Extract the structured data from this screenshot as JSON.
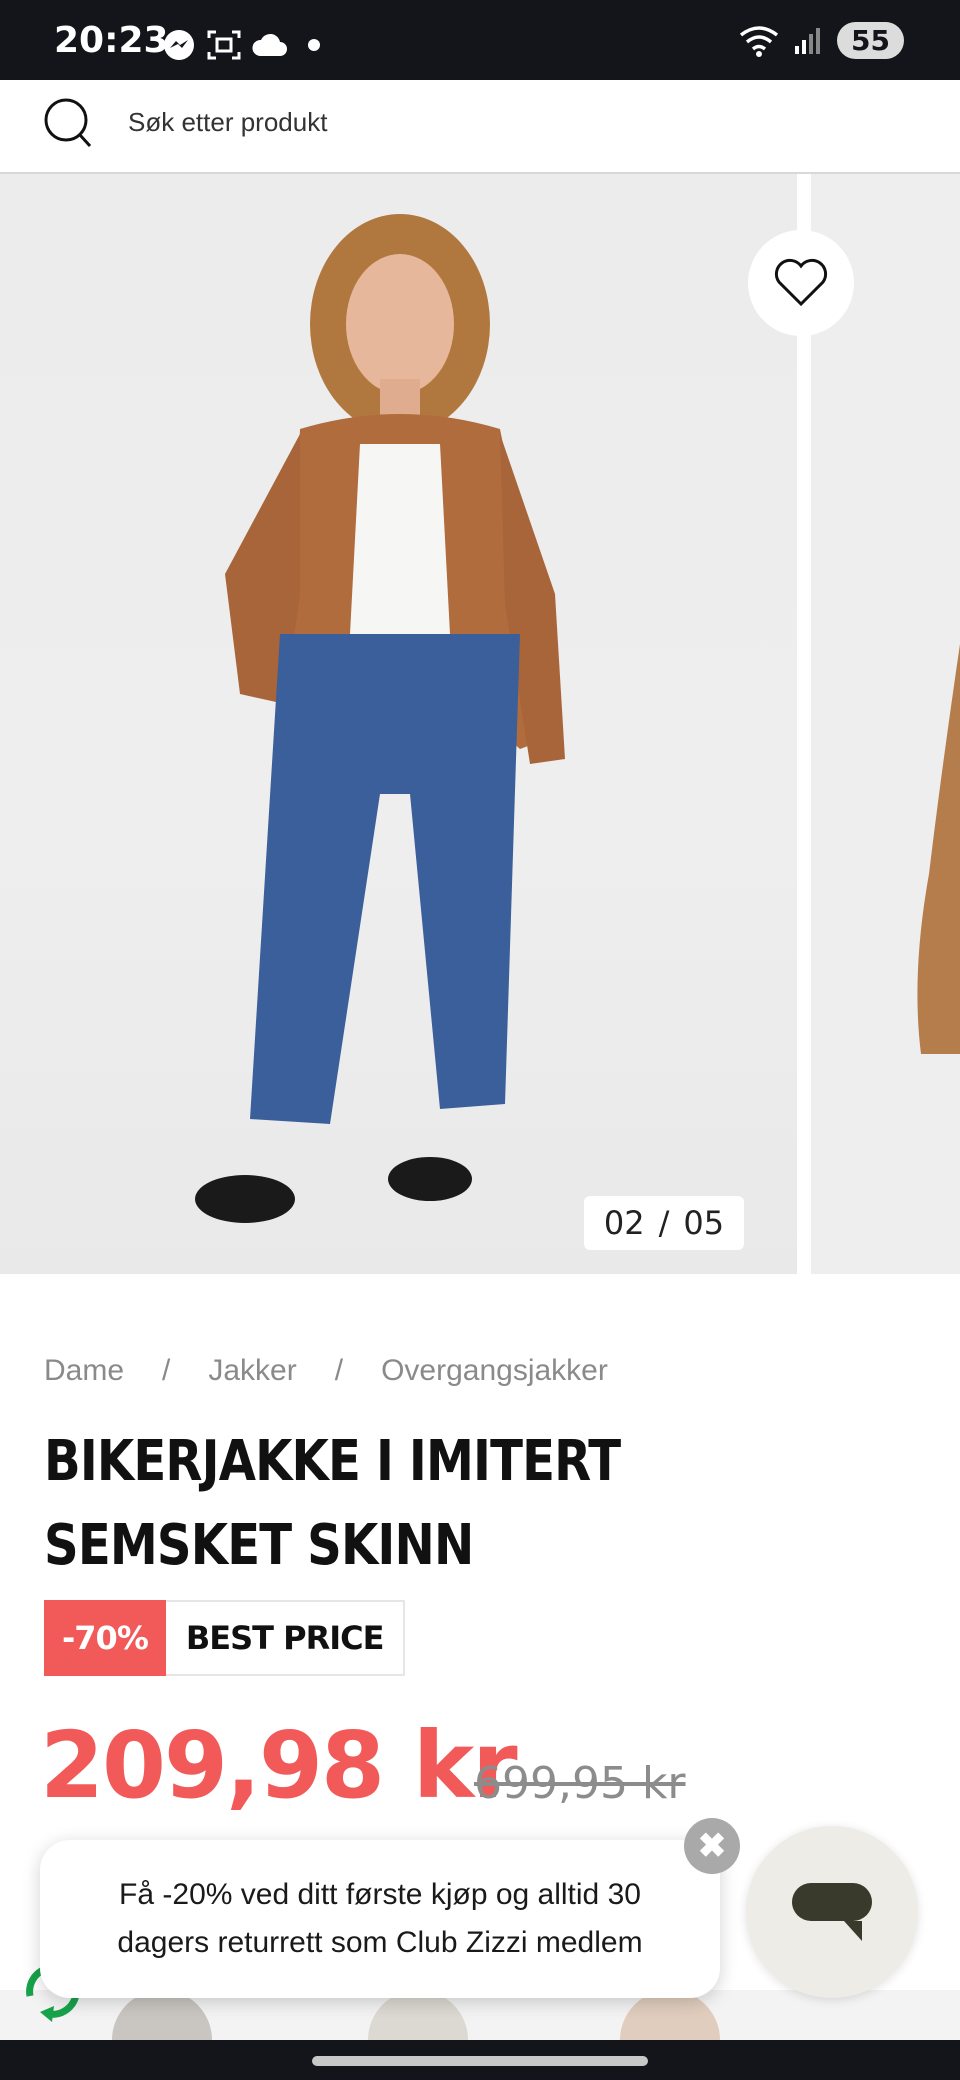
{
  "status_bar": {
    "time": "20:23",
    "battery": "55",
    "icons": [
      "messenger-icon",
      "screenshot-icon",
      "cloud-icon",
      "dot-icon",
      "wifi-icon",
      "signal-icon"
    ]
  },
  "search": {
    "placeholder": "Søk etter produkt"
  },
  "gallery": {
    "current": "02",
    "separator": "/",
    "total": "05"
  },
  "breadcrumb": {
    "items": [
      "Dame",
      "Jakker",
      "Overgangsjakker"
    ],
    "separator": "/"
  },
  "product": {
    "title": "BIKERJAKKE I IMITERT SEMSKET SKINN",
    "discount_badge": "-70%",
    "label_badge": "BEST PRICE",
    "price": "209,98 kr",
    "old_price": "699,95 kr"
  },
  "promo": {
    "text": "Få -20% ved ditt første kjøp og alltid 30 dagers returrett som Club Zizzi medlem",
    "close": "✖"
  },
  "colors": {
    "accent_red": "#f25a5a",
    "status_bar": "#14141b",
    "chat_button": "#eeece6"
  }
}
